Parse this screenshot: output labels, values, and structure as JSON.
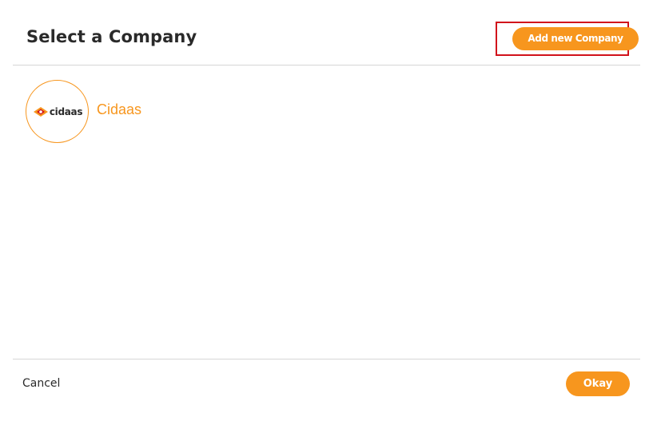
{
  "dialog": {
    "title": "Select a Company",
    "add_button_label": "Add new Company"
  },
  "companies": [
    {
      "name": "Cidaas",
      "logo_text": "cidaas",
      "logo_icon": "cidaas-logo-mark"
    }
  ],
  "footer": {
    "cancel_label": "Cancel",
    "okay_label": "Okay"
  },
  "colors": {
    "accent": "#f7961e",
    "highlight_border": "#d1121b",
    "divider": "#d6d6d6",
    "text": "#2a2a2a"
  }
}
